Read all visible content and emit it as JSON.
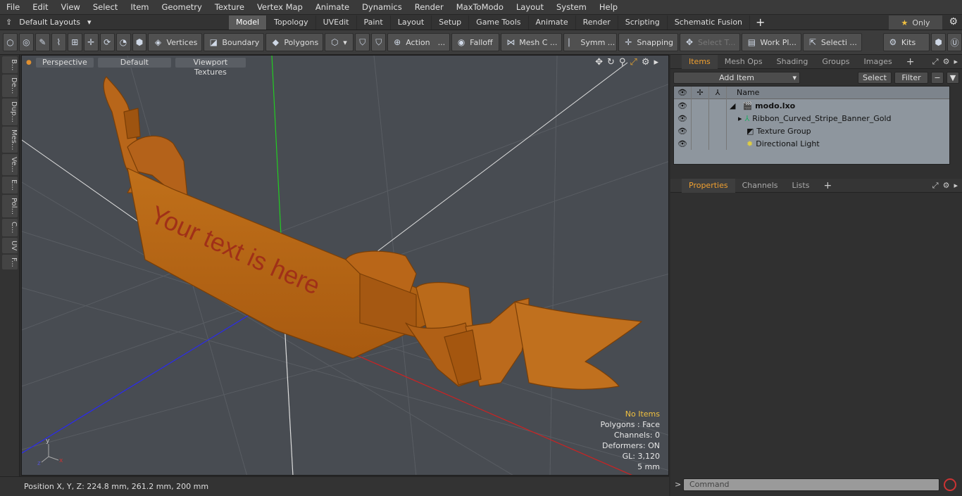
{
  "menu": [
    "File",
    "Edit",
    "View",
    "Select",
    "Item",
    "Geometry",
    "Texture",
    "Vertex Map",
    "Animate",
    "Dynamics",
    "Render",
    "MaxToModo",
    "Layout",
    "System",
    "Help"
  ],
  "layouts_label": "Default Layouts",
  "tabs": [
    "Model",
    "Topology",
    "UVEdit",
    "Paint",
    "Layout",
    "Setup",
    "Game Tools",
    "Animate",
    "Render",
    "Scripting",
    "Schematic Fusion"
  ],
  "only_label": "Only",
  "toolbar": {
    "vertices": "Vertices",
    "boundary": "Boundary",
    "polygons": "Polygons",
    "action": "Action",
    "falloff": "Falloff",
    "mesh": "Mesh C ...",
    "symm": "Symm ...",
    "snapping": "Snapping",
    "select_t": "Select T...",
    "work_pl": "Work Pl...",
    "selecti": "Selecti ...",
    "kits": "Kits",
    "action_more": "..."
  },
  "left_tabs": [
    "B...",
    "De...",
    "Dup...",
    "Mes...",
    "Ve...",
    "E...",
    "Pol...",
    "C...",
    "UV",
    "F..."
  ],
  "viewport": {
    "perspective": "Perspective",
    "default": "Default",
    "textures": "Viewport Textures",
    "banner_text": "Your text is here"
  },
  "stats": {
    "items": "No Items",
    "polygons": "Polygons : Face",
    "channels": "Channels: 0",
    "deformers": "Deformers: ON",
    "gl": "GL: 3,120",
    "size": "5 mm"
  },
  "status": "Position X, Y, Z:   224.8 mm, 261.2 mm, 200 mm",
  "items_panel": {
    "tabs": [
      "Items",
      "Mesh Ops",
      "Shading",
      "Groups",
      "Images"
    ],
    "add_item": "Add Item",
    "select": "Select",
    "filter": "Filter",
    "name_col": "Name",
    "rows": [
      "modo.lxo",
      "Ribbon_Curved_Stripe_Banner_Gold",
      "Texture Group",
      "Directional Light"
    ]
  },
  "props_panel": {
    "tabs": [
      "Properties",
      "Channels",
      "Lists"
    ]
  },
  "command_placeholder": "Command"
}
